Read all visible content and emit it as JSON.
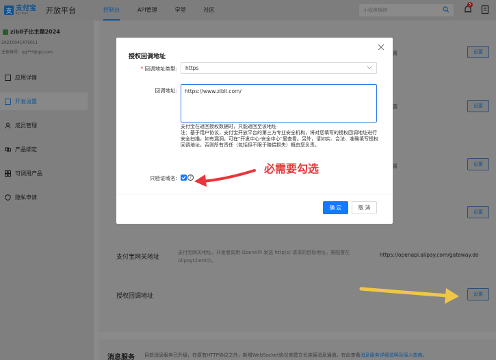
{
  "topbar": {
    "logo_cn": "支付宝",
    "logo_en": "ALIPAY",
    "app_title": "开放平台",
    "nav": [
      "控制台",
      "API管理",
      "学堂",
      "社区"
    ],
    "search_placeholder": "小程序搜待",
    "badge_count": "5"
  },
  "sidebar": {
    "app_name": "zibll子比主题2024",
    "app_id": "20210041476011",
    "app_owner": "主体账号：qq***@qq.com",
    "items": [
      "应用详情",
      "开发设置",
      "成员管理",
      "产品绑定",
      "可调用产品",
      "隐私申请"
    ]
  },
  "main": {
    "set_label": "设置",
    "gateway_label": "支付宝网关地址",
    "gateway_desc": "支付宝网关地址，开发者调用 OpenAPI 发送 http(s) 请求的目标地址，需配置在AlipayClient中。",
    "gateway_value": "https://openapi.alipay.com/gateway.do",
    "callback_label": "授权回调地址",
    "msg_title": "消息服务",
    "msg_text": "目前消息服务已升级，在原有HTTP协议之外，新增WebSocket协议来建立长连接消息通道。在此查看",
    "msg_link": "消息服务详细说明及接入指南",
    "msg_tail": "。",
    "gap_labels": [
      "置",
      "置",
      "置"
    ]
  },
  "modal": {
    "title": "授权回调地址",
    "type_label": "回调地址类型:",
    "type_value": "https",
    "url_label": "回调地址:",
    "url_value": "https://www.zibll.com/",
    "hint": "支付宝在返回授权数据时，只能返回至该地址\n注：基于用户协议，支付宝开放平台的第三方专业安全机构，将对您填写的授权回调地址进行安全扫描，如有漏洞，可在\"开发中心-安全中心\"里查看。另外，请如实、合法、准确填写授权回调地址，否则所有责任（包括但不限于赔偿损失）概由您负责。",
    "verify_label": "只验证域名:",
    "ok": "确 定",
    "cancel": "取 消"
  },
  "annotation": {
    "text": "必需要勾选",
    "colors": {
      "red": "#e8363a",
      "yellow": "#f0c64a"
    }
  }
}
